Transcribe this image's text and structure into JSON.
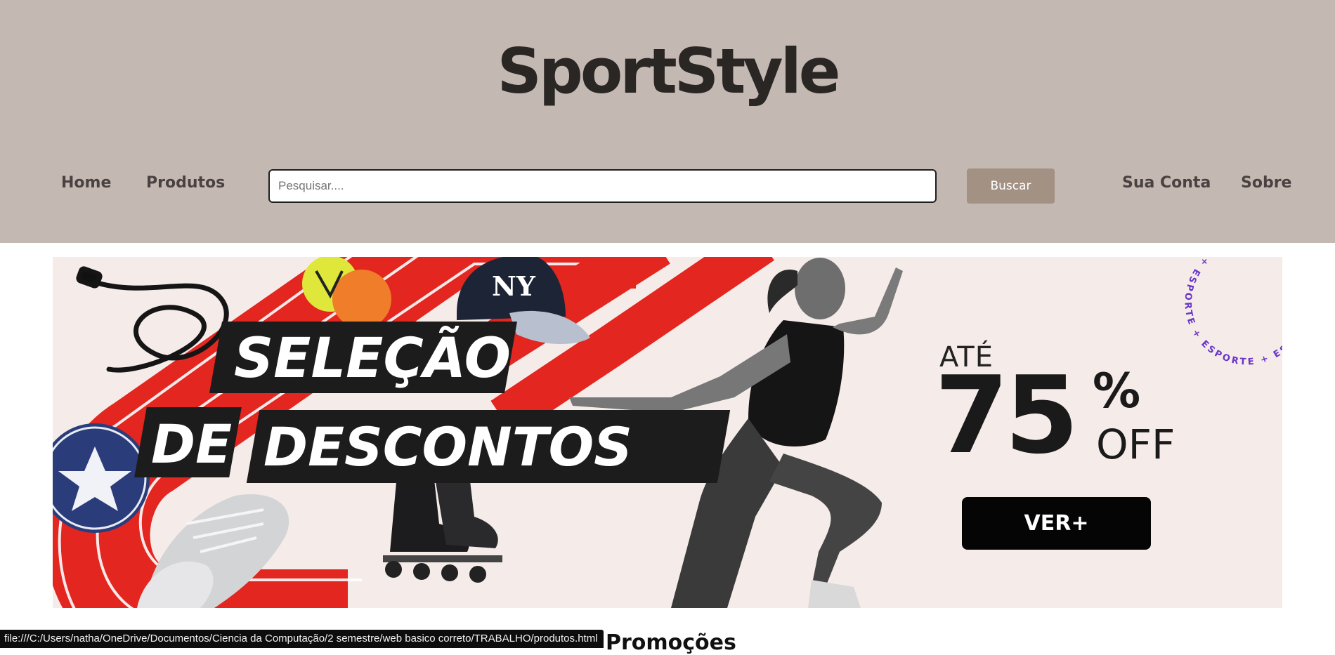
{
  "header": {
    "logo": "SportStyle",
    "nav_left": [
      {
        "label": "Home"
      },
      {
        "label": "Produtos"
      }
    ],
    "search": {
      "placeholder": "Pesquisar....",
      "value": ""
    },
    "search_button": "Buscar",
    "nav_right": [
      {
        "label": "Sua Conta"
      },
      {
        "label": "Sobre"
      }
    ]
  },
  "banner": {
    "headline_line1": "SELEÇÃO",
    "headline_line2a": "DE",
    "headline_line2b": "DESCONTOS",
    "ate": "ATÉ",
    "discount_number": "75",
    "discount_symbol": "%",
    "discount_suffix": "OFF",
    "cta": "VER+",
    "badge_text": "+ ESPORTE + ESPORTE + ESPORTE + ESPORTE",
    "cap_logo": "NY"
  },
  "section_title": "Promoções",
  "status_bar": "file:///C:/Users/natha/OneDrive/Documentos/Ciencia da Computação/2 semestre/web basico correto/TRABALHO/produtos.html",
  "colors": {
    "header_bg": "#c4b8b3",
    "accent_button": "#a39183",
    "banner_bg": "#f5ece9",
    "track_red": "#e3261f",
    "text_dark": "#2a2624"
  }
}
